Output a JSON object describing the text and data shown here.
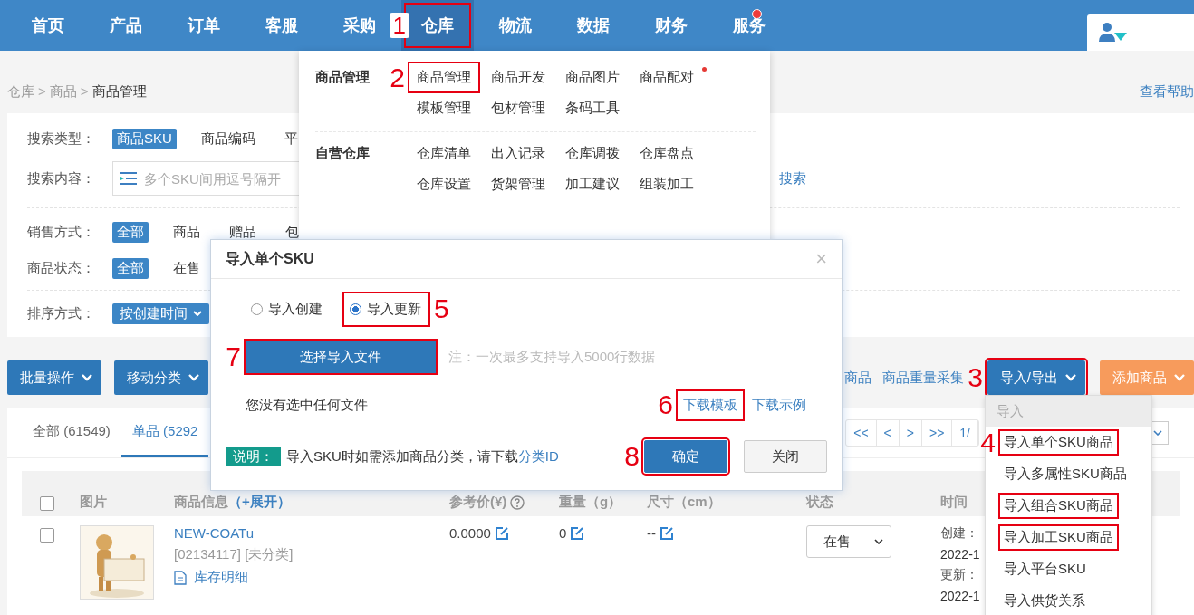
{
  "nav": {
    "items": [
      {
        "label": "首页",
        "selected": false,
        "highlighted": false
      },
      {
        "label": "产品",
        "selected": false,
        "highlighted": false
      },
      {
        "label": "订单",
        "selected": false,
        "highlighted": false
      },
      {
        "label": "客服",
        "selected": false,
        "highlighted": false
      },
      {
        "label": "采购",
        "selected": false,
        "highlighted": false
      },
      {
        "label": "仓库",
        "selected": true,
        "highlighted": true,
        "step": "1"
      },
      {
        "label": "物流",
        "selected": false,
        "highlighted": false
      },
      {
        "label": "数据",
        "selected": false,
        "highlighted": false
      },
      {
        "label": "财务",
        "selected": false,
        "highlighted": false
      },
      {
        "label": "服务",
        "selected": false,
        "highlighted": false,
        "dot": true
      }
    ]
  },
  "breadcrumb": {
    "items": [
      "仓库",
      "商品",
      "商品管理"
    ],
    "separator": ">"
  },
  "help_link": "查看帮助",
  "filters": {
    "search_type": {
      "label": "搜索类型：",
      "options": [
        {
          "label": "商品SKU",
          "selected": true
        },
        {
          "label": "商品编码",
          "selected": false
        },
        {
          "label": "平",
          "selected": false
        }
      ]
    },
    "search_content": {
      "label": "搜索内容：",
      "placeholder": "多个SKU间用逗号隔开",
      "search_link": "搜索"
    },
    "sale_type": {
      "label": "销售方式：",
      "options": [
        {
          "label": "全部",
          "selected": true
        },
        {
          "label": "商品",
          "selected": false
        },
        {
          "label": "赠品",
          "selected": false
        },
        {
          "label": "包",
          "selected": false
        }
      ]
    },
    "status": {
      "label": "商品状态：",
      "options": [
        {
          "label": "全部",
          "selected": true
        },
        {
          "label": "在售",
          "selected": false
        }
      ]
    },
    "sort": {
      "label": "排序方式：",
      "value": "按创建时间"
    }
  },
  "toolbar": {
    "buttons": [
      "批量操作",
      "移动分类"
    ],
    "links": [
      "商品",
      "商品重量采集"
    ],
    "import_export": {
      "label": "导入/导出",
      "highlighted": true,
      "step": "3"
    },
    "add_button": "添加商品"
  },
  "tabs": [
    {
      "label": "全部 (61549)",
      "selected": false
    },
    {
      "label": "单品 (5292",
      "selected": true
    }
  ],
  "pagination": [
    "<<",
    "<",
    ">",
    ">>",
    "1/"
  ],
  "table": {
    "header_checked": false,
    "columns": [
      {
        "label": "图片"
      },
      {
        "label": "商品信息",
        "extra": "（+展开）"
      },
      {
        "label": "参考价(¥)",
        "help": true
      },
      {
        "label": "重量（g）"
      },
      {
        "label": "尺寸（cm）"
      },
      {
        "label": "状态"
      },
      {
        "label": "时间"
      }
    ],
    "rows": [
      {
        "checked": false,
        "sku": "NEW-COATu",
        "code": "[02134117] [未分类]",
        "stock_link": "库存明细",
        "price": "0.0000",
        "weight": "0",
        "size": "--",
        "status": "在售",
        "created_label": "创建：",
        "created": "2022-1",
        "updated_label": "更新：",
        "updated": "2022-1"
      }
    ]
  },
  "nav_menu": {
    "groups": [
      {
        "title": "商品管理",
        "items": [
          {
            "label": "商品管理",
            "highlighted": true,
            "step": "2"
          },
          {
            "label": "商品开发",
            "highlighted": false
          },
          {
            "label": "商品图片",
            "highlighted": false
          },
          {
            "label": "商品配对",
            "highlighted": false,
            "dot": true
          },
          {
            "label": "模板管理",
            "highlighted": false
          },
          {
            "label": "包材管理",
            "highlighted": false
          },
          {
            "label": "条码工具",
            "highlighted": false
          }
        ]
      },
      {
        "title": "自营仓库",
        "items": [
          {
            "label": "仓库清单",
            "highlighted": false
          },
          {
            "label": "出入记录",
            "highlighted": false
          },
          {
            "label": "仓库调拨",
            "highlighted": false
          },
          {
            "label": "仓库盘点",
            "highlighted": false
          },
          {
            "label": "仓库设置",
            "highlighted": false
          },
          {
            "label": "货架管理",
            "highlighted": false
          },
          {
            "label": "加工建议",
            "highlighted": false
          },
          {
            "label": "组装加工",
            "highlighted": false
          }
        ]
      }
    ]
  },
  "dialog": {
    "title": "导入单个SKU",
    "close": "×",
    "modes": [
      {
        "label": "导入创建",
        "selected": false,
        "highlighted": false
      },
      {
        "label": "导入更新",
        "selected": true,
        "highlighted": true,
        "step": "5"
      }
    ],
    "file_button": {
      "label": "选择导入文件",
      "highlighted": true,
      "step": "7"
    },
    "note": "注：一次最多支持导入5000行数据",
    "status": "您没有选中任何文件",
    "links": [
      {
        "label": "下载模板",
        "highlighted": true,
        "step": "6"
      },
      {
        "label": "下载示例",
        "highlighted": false
      }
    ],
    "info_tag": "说明：",
    "info_text": "导入SKU时如需添加商品分类，请下载",
    "info_link": "分类ID",
    "buttons": [
      {
        "label": "确定",
        "kind": "primary",
        "highlighted": true,
        "step": "8"
      },
      {
        "label": "关闭",
        "kind": "default",
        "highlighted": false
      }
    ]
  },
  "import_menu": {
    "header": "导入",
    "items": [
      {
        "label": "导入单个SKU商品",
        "highlighted": true,
        "step": "4"
      },
      {
        "label": "导入多属性SKU商品",
        "highlighted": false
      },
      {
        "label": "导入组合SKU商品",
        "highlighted": true
      },
      {
        "label": "导入加工SKU商品",
        "highlighted": true
      },
      {
        "label": "导入平台SKU",
        "highlighted": false
      },
      {
        "label": "导入供货关系",
        "highlighted": false
      }
    ]
  }
}
